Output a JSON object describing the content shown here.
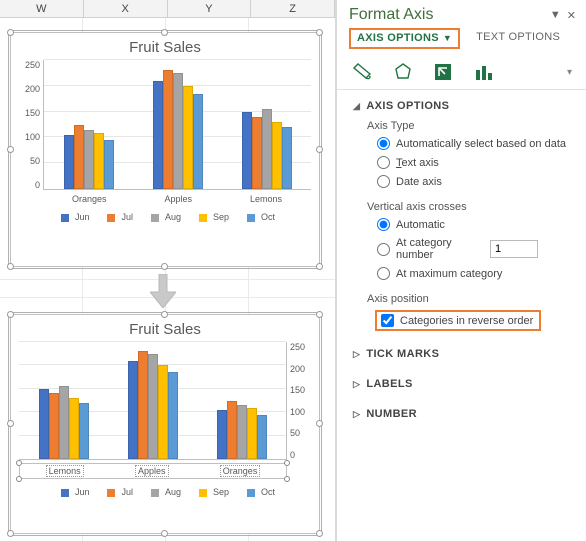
{
  "sheet": {
    "columns": [
      "W",
      "X",
      "Y",
      "Z"
    ]
  },
  "chart1": {
    "title": "Fruit Sales",
    "legend": [
      "Jun",
      "Jul",
      "Aug",
      "Sep",
      "Oct"
    ],
    "categories": [
      "Oranges",
      "Apples",
      "Lemons"
    ]
  },
  "chart2": {
    "title": "Fruit Sales",
    "legend": [
      "Jun",
      "Jul",
      "Aug",
      "Sep",
      "Oct"
    ],
    "categories": [
      "Lemons",
      "Apples",
      "Oranges"
    ]
  },
  "chart_data": [
    {
      "type": "bar",
      "title": "Fruit Sales",
      "categories": [
        "Oranges",
        "Apples",
        "Lemons"
      ],
      "series": [
        {
          "name": "Jun",
          "values": [
            105,
            210,
            150
          ]
        },
        {
          "name": "Jul",
          "values": [
            125,
            230,
            140
          ]
        },
        {
          "name": "Aug",
          "values": [
            115,
            225,
            155
          ]
        },
        {
          "name": "Sep",
          "values": [
            108,
            200,
            130
          ]
        },
        {
          "name": "Oct",
          "values": [
            95,
            185,
            120
          ]
        }
      ],
      "ylim": [
        0,
        250
      ],
      "yticks": [
        0,
        50,
        100,
        150,
        200,
        250
      ],
      "y_axis_side": "left",
      "legend_position": "bottom"
    },
    {
      "type": "bar",
      "title": "Fruit Sales",
      "categories": [
        "Lemons",
        "Apples",
        "Oranges"
      ],
      "series": [
        {
          "name": "Jun",
          "values": [
            150,
            210,
            105
          ]
        },
        {
          "name": "Jul",
          "values": [
            140,
            230,
            125
          ]
        },
        {
          "name": "Aug",
          "values": [
            155,
            225,
            115
          ]
        },
        {
          "name": "Sep",
          "values": [
            130,
            200,
            108
          ]
        },
        {
          "name": "Oct",
          "values": [
            120,
            185,
            95
          ]
        }
      ],
      "ylim": [
        0,
        250
      ],
      "yticks": [
        0,
        50,
        100,
        150,
        200,
        250
      ],
      "y_axis_side": "right",
      "legend_position": "bottom",
      "categories_in_reverse_order": true
    }
  ],
  "pane": {
    "title": "Format Axis",
    "tab_axis_options": "AXIS OPTIONS",
    "tab_text_options": "TEXT OPTIONS",
    "section_axis_options": "AXIS OPTIONS",
    "axis_type_label": "Axis Type",
    "opt_auto": "Automatically select based on data",
    "opt_text_axis": "ext axis",
    "opt_text_axis_m": "T",
    "opt_date_axis": "Date axis",
    "vert_crosses_label": "Vertical axis crosses",
    "opt_automatic": "Automatic",
    "opt_at_cat_num": "At category number",
    "cat_num_value": "1",
    "opt_at_max_cat": "At maximum category",
    "axis_position_label": "Axis position",
    "opt_reverse": "Categories in reverse order",
    "section_tick": "TICK MARKS",
    "section_labels": "LABELS",
    "section_number": "NUMBER"
  },
  "colors": {
    "jun": "#4472c4",
    "jul": "#ed7d31",
    "aug": "#a5a5a5",
    "sep": "#ffc000",
    "oct": "#5b9bd5"
  }
}
